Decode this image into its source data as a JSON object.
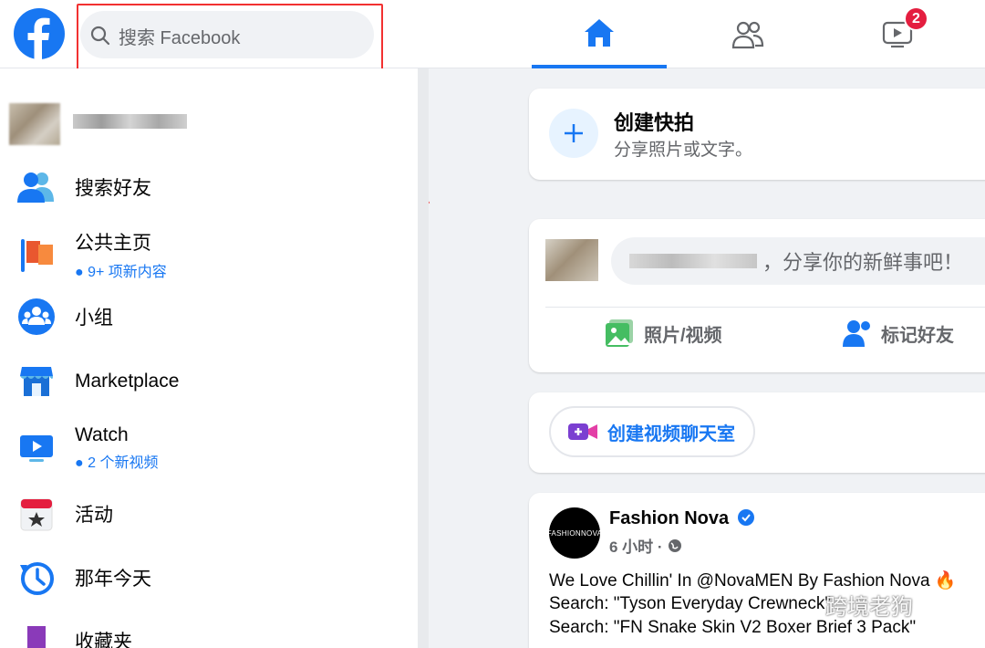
{
  "header": {
    "search_placeholder": "搜索 Facebook",
    "watch_badge": "2"
  },
  "sidebar": {
    "items": [
      {
        "label": "搜索好友",
        "icon": "friends-icon"
      },
      {
        "label": "公共主页",
        "sub": "9+ 项新内容",
        "icon": "flag-icon"
      },
      {
        "label": "小组",
        "icon": "groups-icon"
      },
      {
        "label": "Marketplace",
        "icon": "store-icon"
      },
      {
        "label": "Watch",
        "sub": "2 个新视频",
        "icon": "tv-icon"
      },
      {
        "label": "活动",
        "icon": "calendar-icon"
      },
      {
        "label": "那年今天",
        "icon": "clock-icon"
      },
      {
        "label": "收藏夹",
        "icon": "bookmark-icon"
      }
    ]
  },
  "story": {
    "title": "创建快拍",
    "subtitle": "分享照片或文字。"
  },
  "composer": {
    "prompt": "，分享你的新鲜事吧！",
    "photo_label": "照片/视频",
    "tag_label": "标记好友"
  },
  "room": {
    "label": "创建视频聊天室"
  },
  "post": {
    "author": "Fashion Nova",
    "avatar_text": "FASHIONNOVA",
    "time": "6 小时 ·",
    "lines": [
      "We Love Chillin' In @NovaMEN By Fashion Nova 🔥",
      "Search: \"Tyson Everyday Crewneck\"",
      "Search: \"FN Snake Skin V2 Boxer Brief 3 Pack\""
    ]
  },
  "watermark": "跨境老狗",
  "colors": {
    "accent": "#1877f2",
    "badge": "#e41e3f",
    "annotation": "#f23131"
  }
}
